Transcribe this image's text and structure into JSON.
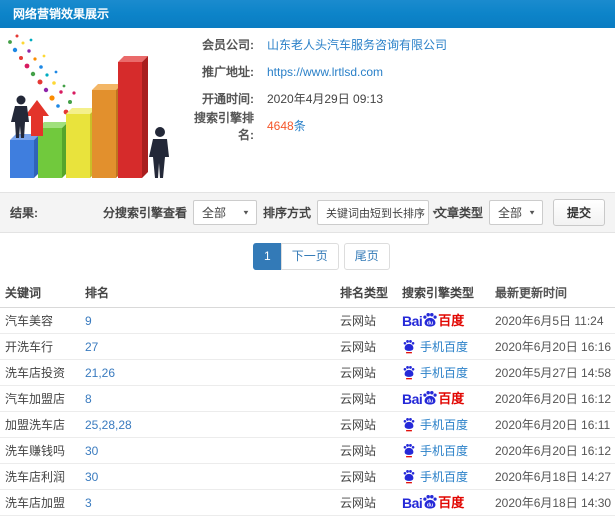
{
  "header": {
    "title": "网络营销效果展示"
  },
  "info": {
    "company_label": "会员公司:",
    "company_value": "山东老人头汽车服务咨询有限公司",
    "url_label": "推广地址:",
    "url_value": "https://www.lrtlsd.com",
    "opened_label": "开通时间:",
    "opened_value": "2020年4月29日 09:13",
    "rank_label": "搜索引擎排名:",
    "rank_value": "4648",
    "rank_unit": "条"
  },
  "filter": {
    "result_label": "结果:",
    "engine_view_label": "分搜索引擎查看",
    "engine_view_value": "全部",
    "sort_label": "排序方式",
    "sort_value": "关键词由短到长排序",
    "article_type_label": "文章类型",
    "article_type_value": "全部",
    "submit_label": "提交"
  },
  "pagination": {
    "current": "1",
    "next": "下一页",
    "last": "尾页"
  },
  "table": {
    "headers": [
      "关键词",
      "排名",
      "排名类型",
      "搜索引擎类型",
      "最新更新时间"
    ],
    "rows": [
      {
        "keyword": "汽车美容",
        "rank": "9",
        "rank_type": "云网站",
        "engine": "baidu",
        "time": "2020年6月5日 11:24"
      },
      {
        "keyword": "开洗车行",
        "rank": "27",
        "rank_type": "云网站",
        "engine": "mobile",
        "time": "2020年6月20日 16:16"
      },
      {
        "keyword": "洗车店投资",
        "rank": "21,26",
        "rank_type": "云网站",
        "engine": "mobile",
        "time": "2020年5月27日 14:58"
      },
      {
        "keyword": "汽车加盟店",
        "rank": "8",
        "rank_type": "云网站",
        "engine": "baidu",
        "time": "2020年6月20日 16:12"
      },
      {
        "keyword": "加盟洗车店",
        "rank": "25,28,28",
        "rank_type": "云网站",
        "engine": "mobile",
        "time": "2020年6月20日 16:11"
      },
      {
        "keyword": "洗车赚钱吗",
        "rank": "30",
        "rank_type": "云网站",
        "engine": "mobile",
        "time": "2020年6月20日 16:12"
      },
      {
        "keyword": "洗车店利润",
        "rank": "30",
        "rank_type": "云网站",
        "engine": "mobile",
        "time": "2020年6月18日 14:27"
      },
      {
        "keyword": "洗车店加盟",
        "rank": "3",
        "rank_type": "云网站",
        "engine": "baidu",
        "time": "2020年6月18日 14:30"
      }
    ]
  },
  "engines": {
    "baidu": {
      "bai": "Bai",
      "du": "du",
      "name": "百度"
    },
    "mobile": {
      "name": "手机百度"
    }
  },
  "colors": {
    "header-blue": "#0d84c9",
    "link-blue": "#2a80c8",
    "accent-orange": "#f4562a",
    "pagination-blue": "#337ab7",
    "baidu-blue": "#2529d8",
    "baidu-red": "#e10602"
  }
}
